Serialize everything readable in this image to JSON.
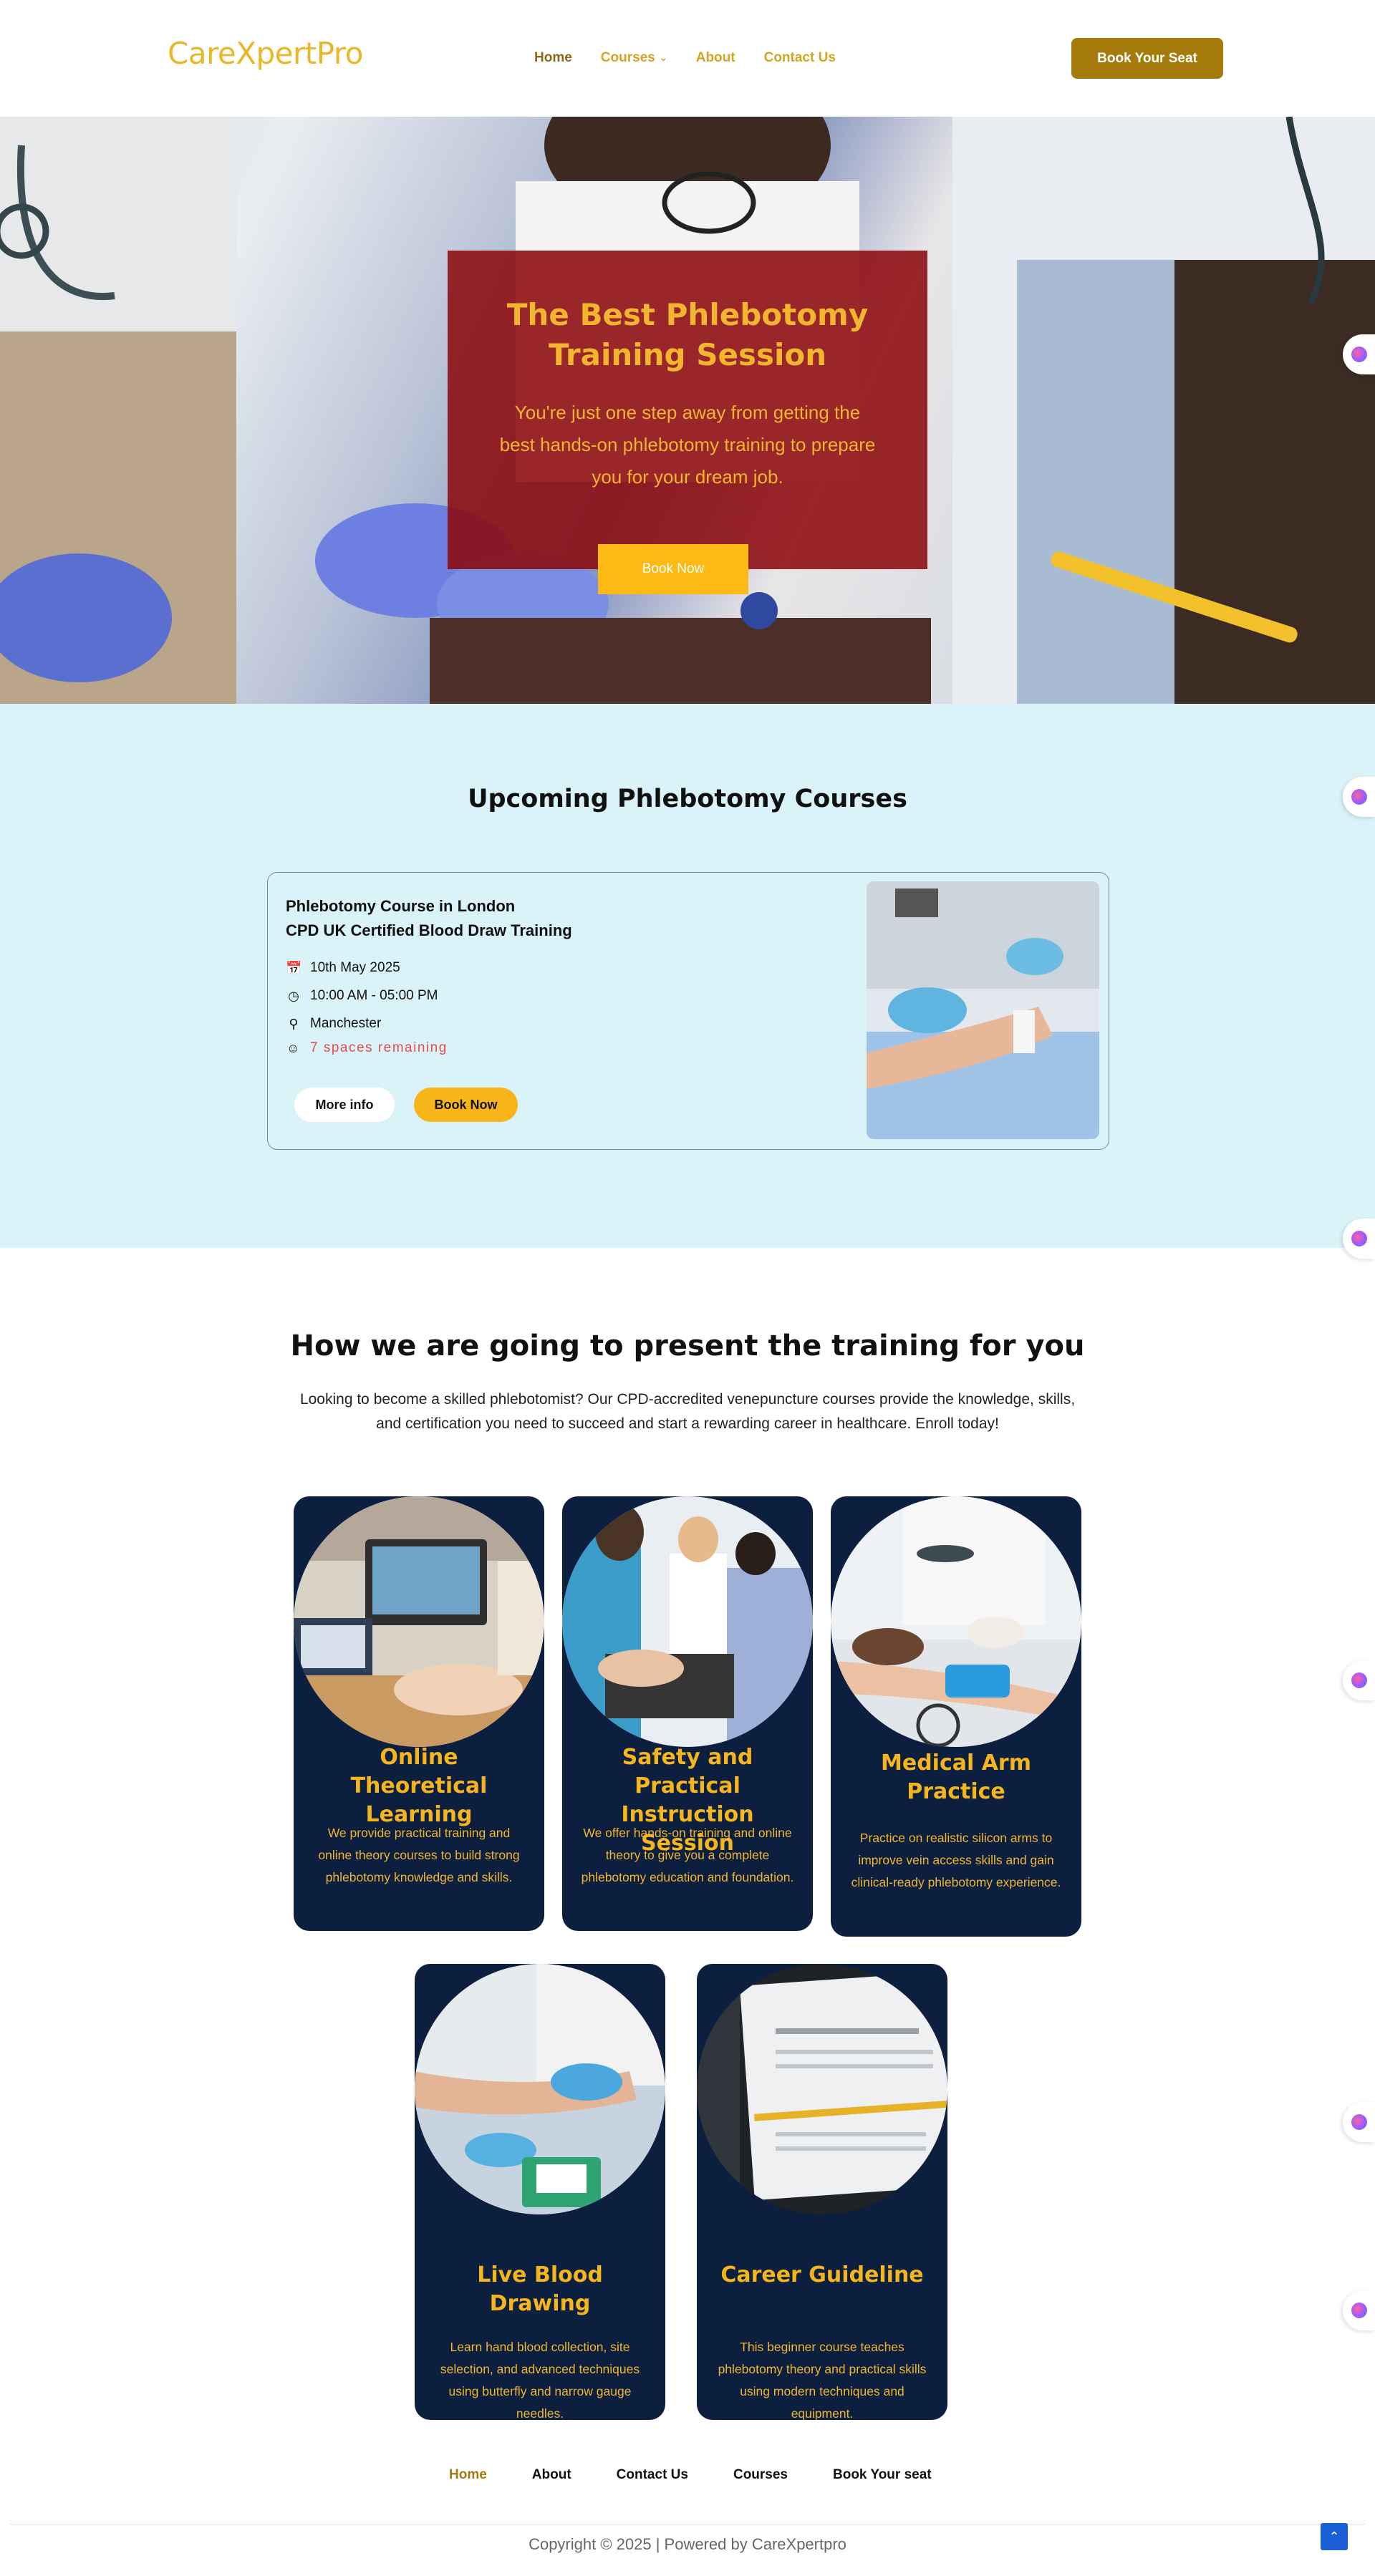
{
  "header": {
    "logo": "CareXpertPro",
    "nav": [
      {
        "label": "Home",
        "active": true
      },
      {
        "label": "Courses",
        "active": false,
        "has_dropdown": true
      },
      {
        "label": "About",
        "active": false
      },
      {
        "label": "Contact Us",
        "active": false
      }
    ],
    "cta": "Book Your Seat"
  },
  "hero": {
    "title": "The Best Phlebotomy Training Session",
    "subtitle": "You're just one step away from getting the best hands-on phlebotomy training to prepare you for your dream job.",
    "button": "Book Now"
  },
  "courses": {
    "heading": "Upcoming Phlebotomy Courses",
    "card": {
      "title_line1": "Phlebotomy Course in London",
      "title_line2": "CPD UK Certified Blood Draw Training",
      "date": "10th May 2025",
      "time": "10:00 AM - 05:00 PM",
      "location": "Manchester",
      "spaces": "7 spaces remaining",
      "more_button": "More info",
      "book_button": "Book Now",
      "icons": [
        "calendar-icon",
        "clock-icon",
        "location-pin-icon",
        "users-icon"
      ]
    }
  },
  "training": {
    "heading": "How we are going to present the training for you",
    "intro": "Looking to become a skilled phlebotomist? Our CPD-accredited venepuncture courses provide the knowledge, skills, and certification you need to succeed and start a rewarding career in healthcare. Enroll today!",
    "cards": [
      {
        "title": "Online Theoretical Learning",
        "body": "We provide practical training and online theory courses to build strong phlebotomy knowledge and skills."
      },
      {
        "title": "Safety and Practical Instruction Session",
        "body": "We offer hands-on training and online theory to give you a complete phlebotomy education and foundation."
      },
      {
        "title": "Medical Arm Practice",
        "body": "Practice on realistic silicon arms to improve vein access skills and gain clinical-ready phlebotomy experience."
      },
      {
        "title": "Live Blood Drawing",
        "body": "Learn hand blood collection, site selection, and advanced techniques using butterfly and narrow gauge needles."
      },
      {
        "title": "Career Guideline",
        "body": "This beginner course teaches phlebotomy theory and practical skills using modern techniques and equipment."
      }
    ]
  },
  "footer": {
    "nav": [
      {
        "label": "Home",
        "active": true
      },
      {
        "label": "About",
        "active": false
      },
      {
        "label": "Contact Us",
        "active": false
      },
      {
        "label": "Courses",
        "active": false
      },
      {
        "label": "Book Your seat",
        "active": false
      }
    ],
    "copyright": "Copyright © 2025 | Powered by CareXpertpro"
  },
  "colors": {
    "brand_gold": "#e9b72a",
    "cta_brown": "#a57c0c",
    "hero_overlay": "#8c0a0e",
    "accent_yellow": "#fdb914",
    "courses_bg": "#d9f3f8",
    "card_navy": "#0c1f3f",
    "alert_red": "#e54b4b"
  }
}
